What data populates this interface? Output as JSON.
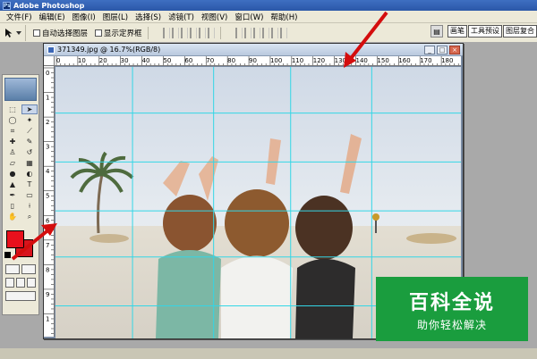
{
  "app": {
    "title": "Adobe Photoshop"
  },
  "menu": [
    "文件(F)",
    "编辑(E)",
    "图像(I)",
    "图层(L)",
    "选择(S)",
    "滤镜(T)",
    "视图(V)",
    "窗口(W)",
    "帮助(H)"
  ],
  "options": {
    "auto_select_layer": "自动选择图层",
    "show_bounding_box": "显示定界框"
  },
  "palette_tabs": [
    "画笔",
    "工具预设",
    "图层复合"
  ],
  "document": {
    "title": "371349.jpg @ 16.7%(RGB/8)",
    "ruler_labels": [
      "0",
      "10",
      "20",
      "30",
      "40",
      "50",
      "60",
      "70",
      "80",
      "90",
      "100",
      "110",
      "120",
      "130",
      "140",
      "150",
      "160",
      "170",
      "180"
    ],
    "ruler_v_labels": [
      "0",
      "1",
      "2",
      "3",
      "4",
      "5",
      "6",
      "7",
      "8",
      "9",
      "1"
    ]
  },
  "colors": {
    "foreground": "#e8101c",
    "background": "#d8141d",
    "guide": "#33d6e6",
    "watermark_bg": "#1a9d3e"
  },
  "watermark": {
    "main": "百科全说",
    "sub": "助你轻松解决"
  },
  "icons": [
    "photoshop-logo-icon",
    "move-tool-icon",
    "marquee-icon",
    "lasso-icon",
    "magic-wand-icon",
    "crop-icon",
    "slice-icon",
    "healing-brush-icon",
    "brush-icon",
    "clone-stamp-icon",
    "history-brush-icon",
    "eraser-icon",
    "gradient-icon",
    "blur-icon",
    "dodge-icon",
    "path-select-icon",
    "type-icon",
    "pen-icon",
    "shape-icon",
    "notes-icon",
    "eyedropper-icon",
    "hand-icon",
    "zoom-icon"
  ]
}
